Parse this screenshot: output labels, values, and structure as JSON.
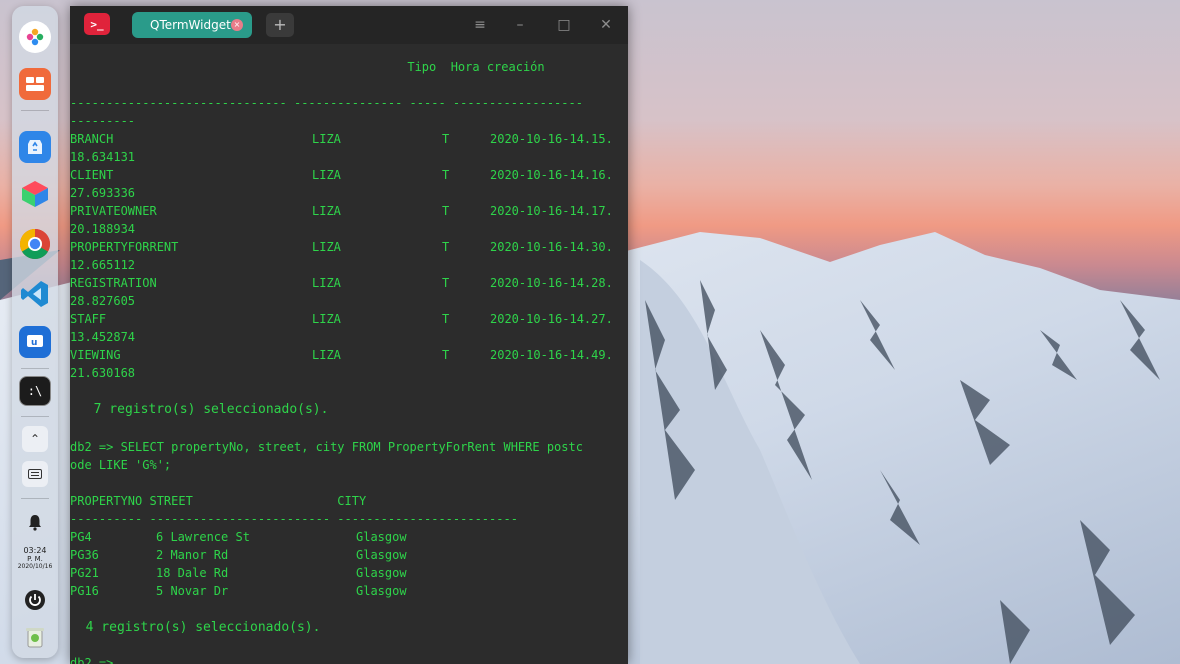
{
  "terminal": {
    "tab_title": "QTermWidget",
    "tab_close_glyph": "×",
    "add_tab_glyph": "+",
    "menu_glyph": "≡",
    "minimize_glyph": "–",
    "maximize_glyph": "□",
    "close_glyph": "✕",
    "app_icon_glyph": ">_",
    "output": {
      "header_line": "                                                       Tipo  Hora creación",
      "dash_line_1": "------------------------------ --------------- ----- ------------------",
      "dash_line_2": "---------",
      "tables": [
        {
          "name": "BRANCH",
          "schema": "LIZA",
          "type": "T",
          "created": "2020-10-16-14.15.",
          "created_cont": "18.634131"
        },
        {
          "name": "CLIENT",
          "schema": "LIZA",
          "type": "T",
          "created": "2020-10-16-14.16.",
          "created_cont": "27.693336"
        },
        {
          "name": "PRIVATEOWNER",
          "schema": "LIZA",
          "type": "T",
          "created": "2020-10-16-14.17.",
          "created_cont": "20.188934"
        },
        {
          "name": "PROPERTYFORRENT",
          "schema": "LIZA",
          "type": "T",
          "created": "2020-10-16-14.30.",
          "created_cont": "12.665112"
        },
        {
          "name": "REGISTRATION",
          "schema": "LIZA",
          "type": "T",
          "created": "2020-10-16-14.28.",
          "created_cont": "28.827605"
        },
        {
          "name": "STAFF",
          "schema": "LIZA",
          "type": "T",
          "created": "2020-10-16-14.27.",
          "created_cont": "13.452874"
        },
        {
          "name": "VIEWING",
          "schema": "LIZA",
          "type": "T",
          "created": "2020-10-16-14.49.",
          "created_cont": "21.630168"
        }
      ],
      "summary_1": "  7 registro(s) seleccionado(s).",
      "query_line_1": "db2 => SELECT propertyNo, street, city FROM PropertyForRent WHERE postc",
      "query_line_2": "ode LIKE 'G%';",
      "result_header": "PROPERTYNO STREET                    CITY",
      "result_dashes": "---------- ------------------------- -------------------------",
      "rows": [
        {
          "no": "PG4",
          "street": "6 Lawrence St",
          "city": "Glasgow"
        },
        {
          "no": "PG36",
          "street": "2 Manor Rd",
          "city": "Glasgow"
        },
        {
          "no": "PG21",
          "street": "18 Dale Rd",
          "city": "Glasgow"
        },
        {
          "no": "PG16",
          "street": "5 Novar Dr",
          "city": "Glasgow"
        }
      ],
      "summary_2": "  4 registro(s) seleccionado(s).",
      "prompt": "db2 =>"
    }
  },
  "dock": {
    "clock_time": "03:24",
    "clock_ampm": "P. M.",
    "clock_date": "2020/10/16",
    "items": [
      {
        "name": "launcher-icon"
      },
      {
        "name": "multitask-view-icon"
      },
      {
        "name": "app-store-icon"
      },
      {
        "name": "cube-app-icon"
      },
      {
        "name": "chrome-icon"
      },
      {
        "name": "vscode-icon"
      },
      {
        "name": "chat-app-icon"
      },
      {
        "name": "terminal-icon"
      }
    ]
  },
  "colors": {
    "terminal_text": "#2ed44a",
    "terminal_bg": "#2c2c2c",
    "tab_active": "#2a9b8a",
    "app_icon": "#e0233b"
  }
}
